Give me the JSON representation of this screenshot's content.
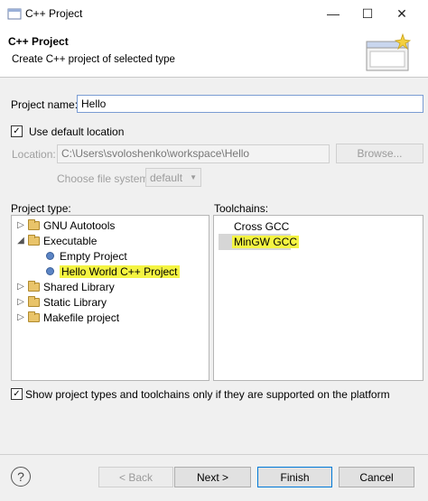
{
  "window": {
    "title": "C++ Project"
  },
  "header": {
    "title": "C++ Project",
    "description": "Create C++ project of selected type"
  },
  "form": {
    "project_name_label": "Project name:",
    "project_name_value": "Hello",
    "use_default_location_label": "Use default location",
    "use_default_location_checked": true,
    "location_label": "Location:",
    "location_value": "C:\\Users\\svoloshenko\\workspace\\Hello",
    "browse_label": "Browse...",
    "file_system_label": "Choose file system:",
    "file_system_value": "default"
  },
  "project_type": {
    "label": "Project type:",
    "items": [
      {
        "label": "GNU Autotools",
        "expanded": false,
        "level": 0,
        "kind": "folder"
      },
      {
        "label": "Executable",
        "expanded": true,
        "level": 0,
        "kind": "folder"
      },
      {
        "label": "Empty Project",
        "level": 1,
        "kind": "item"
      },
      {
        "label": "Hello World C++ Project",
        "level": 1,
        "kind": "item",
        "selected": true,
        "highlighted": true
      },
      {
        "label": "Shared Library",
        "expanded": false,
        "level": 0,
        "kind": "folder"
      },
      {
        "label": "Static Library",
        "expanded": false,
        "level": 0,
        "kind": "folder"
      },
      {
        "label": "Makefile project",
        "expanded": false,
        "level": 0,
        "kind": "folder"
      }
    ]
  },
  "toolchains": {
    "label": "Toolchains:",
    "items": [
      {
        "label": "Cross GCC"
      },
      {
        "label": "MinGW GCC",
        "selected": true,
        "highlighted": true
      }
    ]
  },
  "platform_filter": {
    "label": "Show project types and toolchains only if they are supported on the platform",
    "checked": true
  },
  "buttons": {
    "help": "?",
    "back": "< Back",
    "next": "Next >",
    "finish": "Finish",
    "cancel": "Cancel"
  },
  "colors": {
    "highlight": "#f4f442",
    "accent": "#0078d7"
  },
  "icons": {
    "app": "cpp-project-icon",
    "wizard": "wizard-banner-icon",
    "folder": "folder-icon",
    "item": "template-dot-icon",
    "help": "help-icon"
  }
}
